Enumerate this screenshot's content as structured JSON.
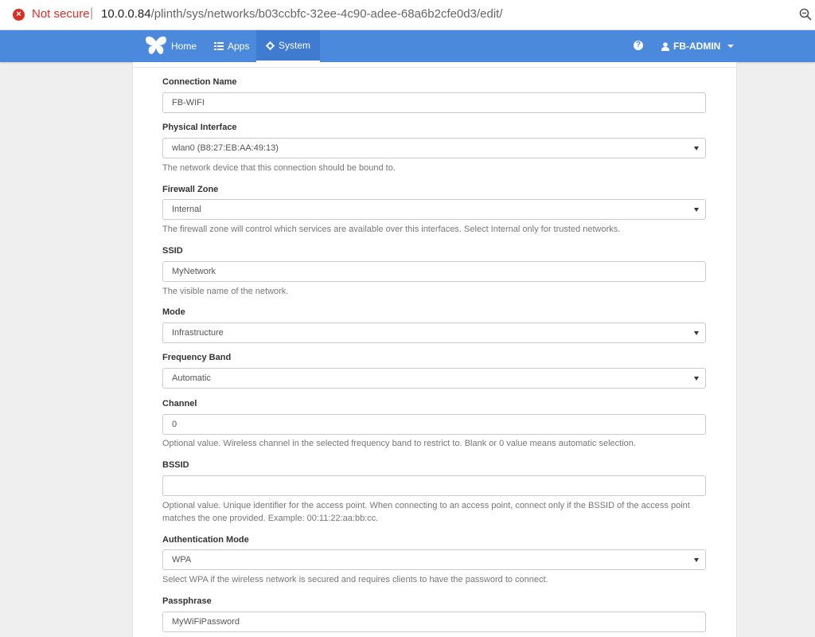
{
  "browser": {
    "security_label": "Not secure",
    "url_host": "10.0.0.84",
    "url_path": "/plinth/sys/networks/b03ccbfc-32ee-4c90-adee-68a6b2cfe0d3/edit/"
  },
  "navbar": {
    "home_label": "Home",
    "apps_label": "Apps",
    "system_label": "System",
    "help_glyph": "?",
    "user_label": "FB-ADMIN",
    "accent_color": "#4a89dc"
  },
  "form": {
    "connection_name": {
      "label": "Connection Name",
      "value": "FB-WIFI"
    },
    "physical_interface": {
      "label": "Physical Interface",
      "value": "wlan0 (B8:27:EB:AA:49:13)",
      "help": "The network device that this connection should be bound to."
    },
    "firewall_zone": {
      "label": "Firewall Zone",
      "value": "Internal",
      "help": "The firewall zone will control which services are available over this interfaces. Select Internal only for trusted networks."
    },
    "ssid": {
      "label": "SSID",
      "value": "MyNetwork",
      "help": "The visible name of the network."
    },
    "mode": {
      "label": "Mode",
      "value": "Infrastructure"
    },
    "frequency_band": {
      "label": "Frequency Band",
      "value": "Automatic"
    },
    "channel": {
      "label": "Channel",
      "value": "0",
      "help": "Optional value. Wireless channel in the selected frequency band to restrict to. Blank or 0 value means automatic selection."
    },
    "bssid": {
      "label": "BSSID",
      "value": "",
      "help": "Optional value. Unique identifier for the access point. When connecting to an access point, connect only if the BSSID of the access point matches the one provided. Example: 00:11:22:aa:bb:cc."
    },
    "authentication_mode": {
      "label": "Authentication Mode",
      "value": "WPA",
      "help": "Select WPA if the wireless network is secured and requires clients to have the password to connect."
    },
    "passphrase": {
      "label": "Passphrase",
      "value": "MyWiFiPassword"
    }
  }
}
